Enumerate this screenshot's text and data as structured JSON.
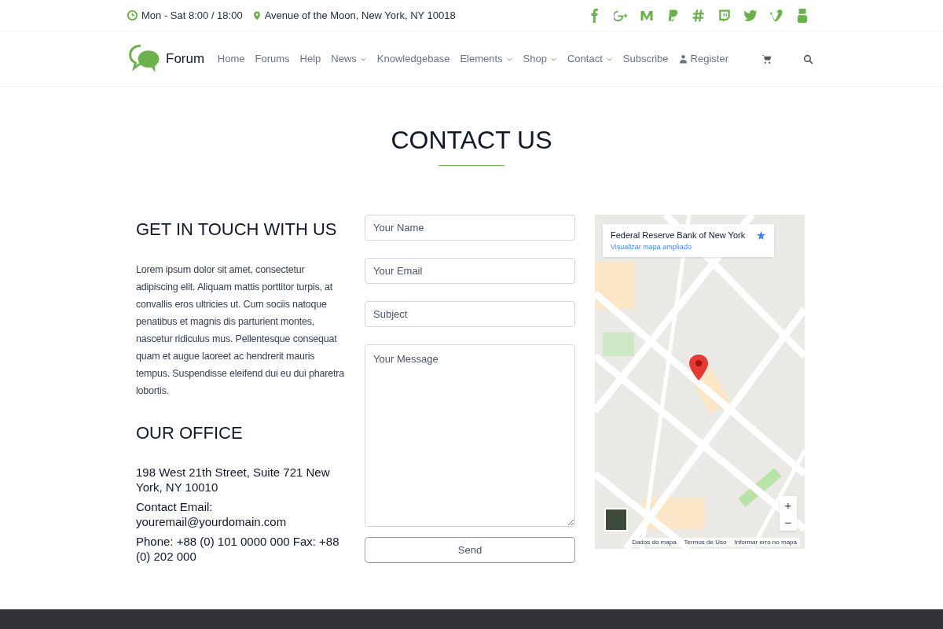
{
  "topbar": {
    "hours": "Mon - Sat 8:00 / 18:00",
    "address": "Avenue of the Moon, New York, NY 10018"
  },
  "brand": "Forum",
  "nav": [
    {
      "label": "Home",
      "dropdown": false
    },
    {
      "label": "Forums",
      "dropdown": false
    },
    {
      "label": "Help",
      "dropdown": false
    },
    {
      "label": "News",
      "dropdown": true
    },
    {
      "label": "Knowledgebase",
      "dropdown": false
    },
    {
      "label": "Elements",
      "dropdown": true
    },
    {
      "label": "Shop",
      "dropdown": true
    },
    {
      "label": "Contact",
      "dropdown": true
    },
    {
      "label": "Subscribe",
      "dropdown": false
    },
    {
      "label": "Register",
      "dropdown": false,
      "kind": "user"
    }
  ],
  "page_title": "CONTACT US",
  "touch": {
    "heading": "GET IN TOUCH WITH US",
    "text": "Lorem ipsum dolor sit amet, consectetur adipiscing elit. Aliquam mattis porttitor turpis, at convallis eros ultricies ut. Cum sociis natoque penatibus et magnis dis parturient montes, nascetur ridiculus mus. Pellentesque consequat quam et augue laoreet ac hendrerit mauris tempus. Suspendisse eleifend dui eu dui pharetra lobortis."
  },
  "office": {
    "heading": "OUR OFFICE",
    "lines": [
      "198 West 21th Street, Suite 721 New York, NY 10010",
      "Contact Email: youremail@yourdomain.com",
      "Phone: +88 (0) 101 0000 000 Fax: +88 (0) 202 000"
    ]
  },
  "form": {
    "fields": [
      {
        "kind": "input",
        "placeholder": "Your Name"
      },
      {
        "kind": "input",
        "placeholder": "Your Email"
      },
      {
        "kind": "input",
        "placeholder": "Subject"
      },
      {
        "kind": "textarea",
        "placeholder": "Your Message"
      }
    ],
    "submit": "Send"
  },
  "map": {
    "place": "Federal Reserve Bank of New York",
    "link": "Visualizar mapa ampliado",
    "zoom_in": "+",
    "zoom_out": "−",
    "attribution": [
      "Dados do mapa",
      "Termos de Uso",
      "Informar erro no mapa"
    ]
  }
}
